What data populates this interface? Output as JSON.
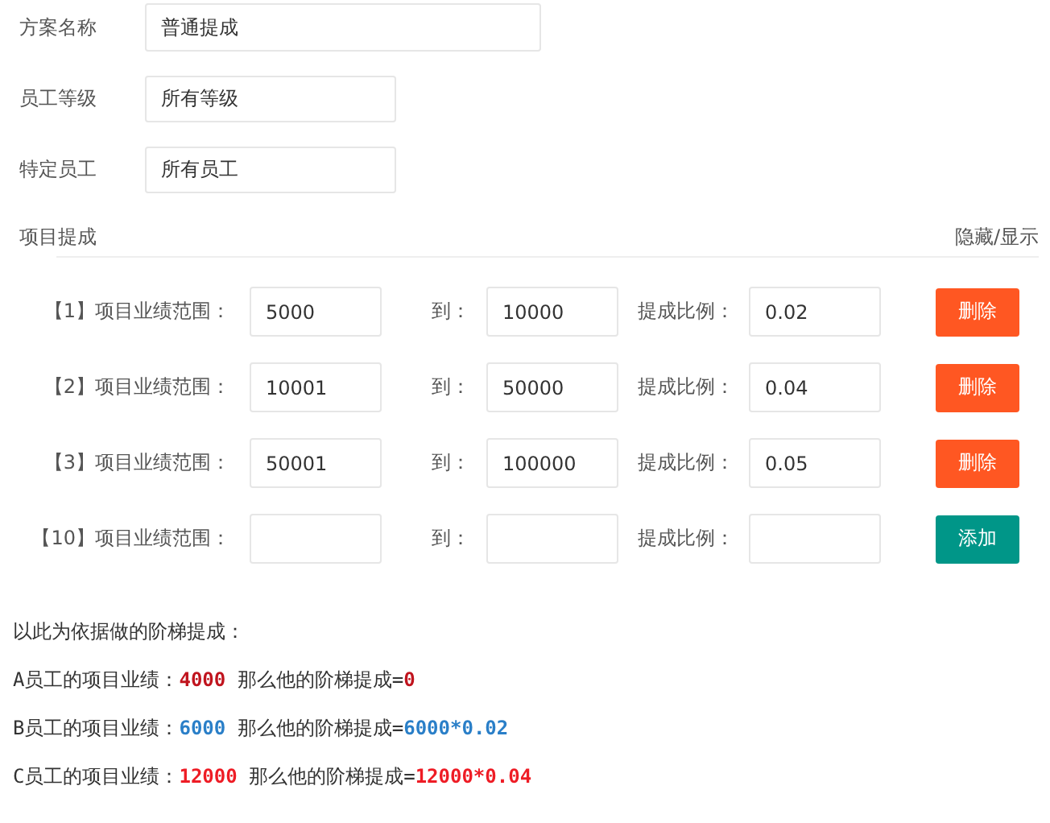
{
  "fields": [
    {
      "label": "方案名称",
      "value": "普通提成",
      "kind": "wide"
    },
    {
      "label": "员工等级",
      "value": "所有等级",
      "kind": "narrow"
    },
    {
      "label": "特定员工",
      "value": "所有员工",
      "kind": "narrow"
    }
  ],
  "section": {
    "title": "项目提成",
    "toggle": "隐藏/显示"
  },
  "tiers": [
    {
      "label": "【1】项目业绩范围：",
      "from": "5000",
      "to_label": "到：",
      "to": "10000",
      "rate_label": "提成比例：",
      "rate": "0.02",
      "button": {
        "label": "删除",
        "kind": "delete"
      }
    },
    {
      "label": "【2】项目业绩范围：",
      "from": "10001",
      "to_label": "到：",
      "to": "50000",
      "rate_label": "提成比例：",
      "rate": "0.04",
      "button": {
        "label": "删除",
        "kind": "delete"
      }
    },
    {
      "label": "【3】项目业绩范围：",
      "from": "50001",
      "to_label": "到：",
      "to": "100000",
      "rate_label": "提成比例：",
      "rate": "0.05",
      "button": {
        "label": "删除",
        "kind": "delete"
      }
    },
    {
      "label": "【10】项目业绩范围：",
      "to_label": "到：",
      "rate_label": "提成比例：",
      "button": {
        "label": "添加",
        "kind": "add"
      }
    }
  ],
  "note": "以此为依据做的阶梯提成：",
  "examples": [
    {
      "segments": [
        {
          "text": "A员工的项目业绩：",
          "color": "#333333"
        },
        {
          "text": "4000",
          "color": "#c0141e"
        },
        {
          "text": " 那么他的阶梯提成=",
          "color": "#333333"
        },
        {
          "text": "0",
          "color": "#c0141e"
        }
      ]
    },
    {
      "segments": [
        {
          "text": "B员工的项目业绩：",
          "color": "#333333"
        },
        {
          "text": "6000",
          "color": "#2a7fc8"
        },
        {
          "text": " 那么他的阶梯提成=",
          "color": "#333333"
        },
        {
          "text": "6000*0.02",
          "color": "#2a7fc8"
        }
      ]
    },
    {
      "segments": [
        {
          "text": "C员工的项目业绩：",
          "color": "#333333"
        },
        {
          "text": "12000",
          "color": "#ee1c25"
        },
        {
          "text": " 那么他的阶梯提成=",
          "color": "#333333"
        },
        {
          "text": "12000*0.04",
          "color": "#ee1c25"
        }
      ]
    }
  ]
}
